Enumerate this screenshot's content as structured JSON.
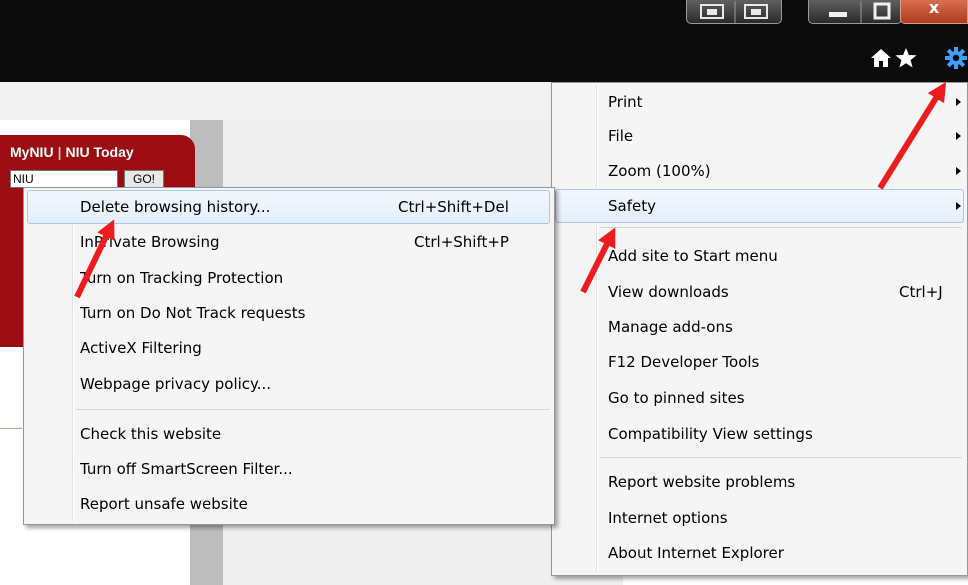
{
  "chrome": {
    "close_glyph": "x",
    "icons": [
      "home-icon",
      "favorites-star-icon",
      "tools-gear-icon"
    ],
    "colors": {
      "chrome_bg": "#0b0b0b",
      "close": "#c8482a",
      "gear": "#3aa0ff"
    }
  },
  "page": {
    "nav_links": [
      "MyNIU",
      "NIU Today"
    ],
    "search_value": "NIU",
    "go_label": "GO!"
  },
  "tools_menu": {
    "items": [
      {
        "label": "Print",
        "submenu": true
      },
      {
        "label": "File",
        "submenu": true
      },
      {
        "label": "Zoom (100%)",
        "submenu": true
      },
      {
        "label": "Safety",
        "submenu": true,
        "highlighted": true
      },
      {
        "label": "Add site to Start menu"
      },
      {
        "label": "View downloads",
        "shortcut": "Ctrl+J"
      },
      {
        "label": "Manage add-ons"
      },
      {
        "label": "F12 Developer Tools"
      },
      {
        "label": "Go to pinned sites"
      },
      {
        "label": "Compatibility View settings"
      },
      {
        "label": "Report website problems"
      },
      {
        "label": "Internet options"
      },
      {
        "label": "About Internet Explorer"
      }
    ]
  },
  "safety_menu": {
    "items": [
      {
        "label": "Delete browsing history...",
        "shortcut": "Ctrl+Shift+Del",
        "highlighted": true
      },
      {
        "label": "InPrivate Browsing",
        "shortcut": "Ctrl+Shift+P"
      },
      {
        "label": "Turn on Tracking Protection"
      },
      {
        "label": "Turn on Do Not Track requests"
      },
      {
        "label": "ActiveX Filtering"
      },
      {
        "label": "Webpage privacy policy..."
      },
      {
        "label": "Check this website"
      },
      {
        "label": "Turn off SmartScreen Filter..."
      },
      {
        "label": "Report unsafe website"
      }
    ]
  },
  "annotations": {
    "arrow_color": "#ee1c1c"
  }
}
